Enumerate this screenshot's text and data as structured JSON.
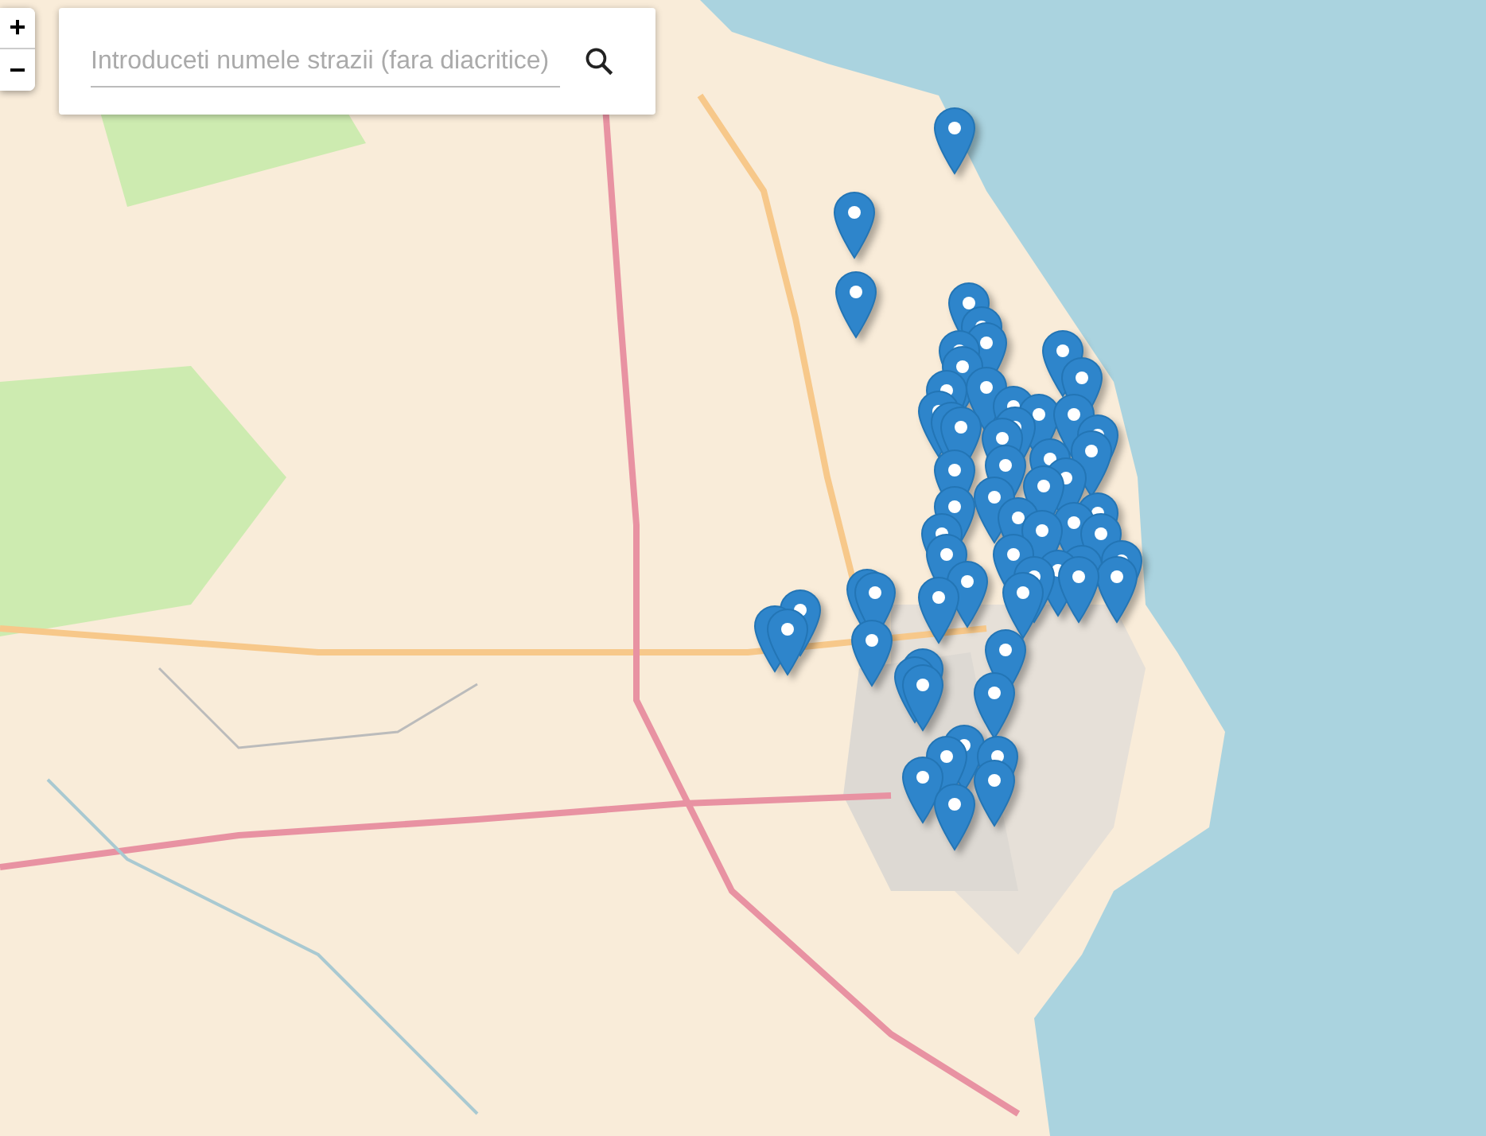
{
  "zoom_controls": [
    {
      "label": "+"
    },
    {
      "label": "−"
    }
  ],
  "search": {
    "placeholder": "Introduceti numele strazii (fara diacritice)"
  }
}
